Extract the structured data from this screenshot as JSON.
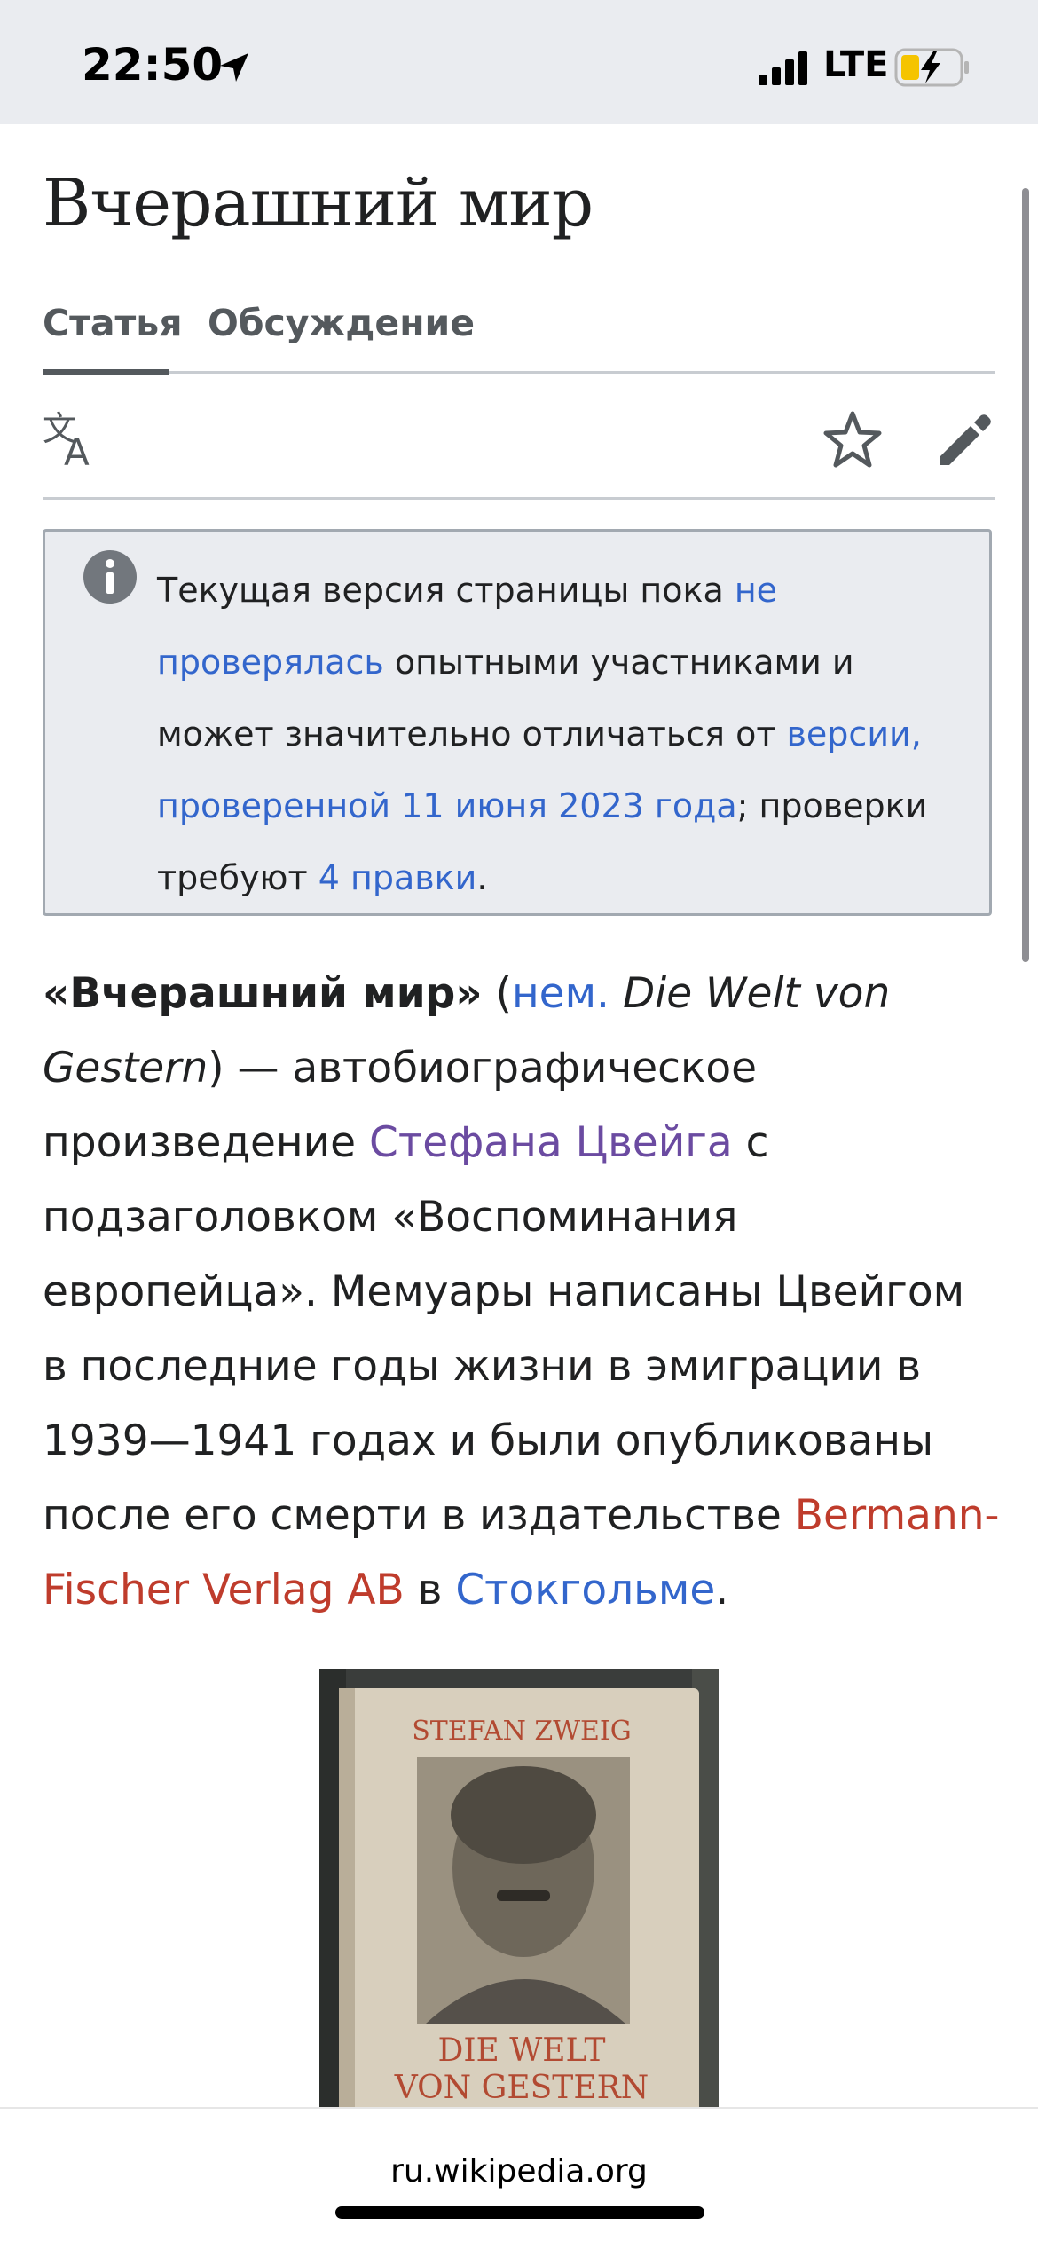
{
  "status_bar": {
    "time": "22:50",
    "network": "LTE",
    "icons": [
      "location-arrow-icon",
      "signal-bars-icon",
      "battery-charging-icon"
    ],
    "battery_color": "#f5c400"
  },
  "page": {
    "title": "Вчерашний мир",
    "tabs": [
      {
        "label": "Статья",
        "active": true
      },
      {
        "label": "Обсуждение",
        "active": false
      }
    ],
    "toolbar": {
      "language_icon": "translate-icon",
      "watch_icon": "star-icon",
      "edit_icon": "pencil-icon"
    }
  },
  "notice": {
    "icon": "info-icon",
    "part1": "Текущая версия страницы пока ",
    "link1": "не проверялась",
    "part2": " опытными участниками и может значительно отличаться от ",
    "link2": "версии, проверенной 11 июня 2023 года",
    "part3": "; проверки требуют ",
    "link3": "4 правки",
    "part4": "."
  },
  "article": {
    "bold_title": "«Вчерашний мир»",
    "open_paren": " (",
    "lang_link": "нем.",
    "german_title": "Die Welt von Gestern",
    "text1": ") — автобиографическое произведение ",
    "author_link": "Стефана Цвейга",
    "text2": " с подзаголовком «Воспоминания европейца». Мемуары написаны Цвейгом в последние годы жизни в эмиграции в 1939—1941 годах и были опубликованы после его смерти в издательстве ",
    "publisher_link": "Bermann-Fischer Verlag AB",
    "text3": " в ",
    "city_link": "Стокгольме",
    "text4": "."
  },
  "book_image": {
    "author": "STEFAN ZWEIG",
    "title_line1": "DIE WELT",
    "title_line2": "VON GESTERN"
  },
  "browser": {
    "url": "ru.wikipedia.org"
  },
  "colors": {
    "link": "#3366cc",
    "visited_link": "#6b4ba1",
    "red_link": "#bf3c2c",
    "notice_bg": "#eaecf0"
  }
}
